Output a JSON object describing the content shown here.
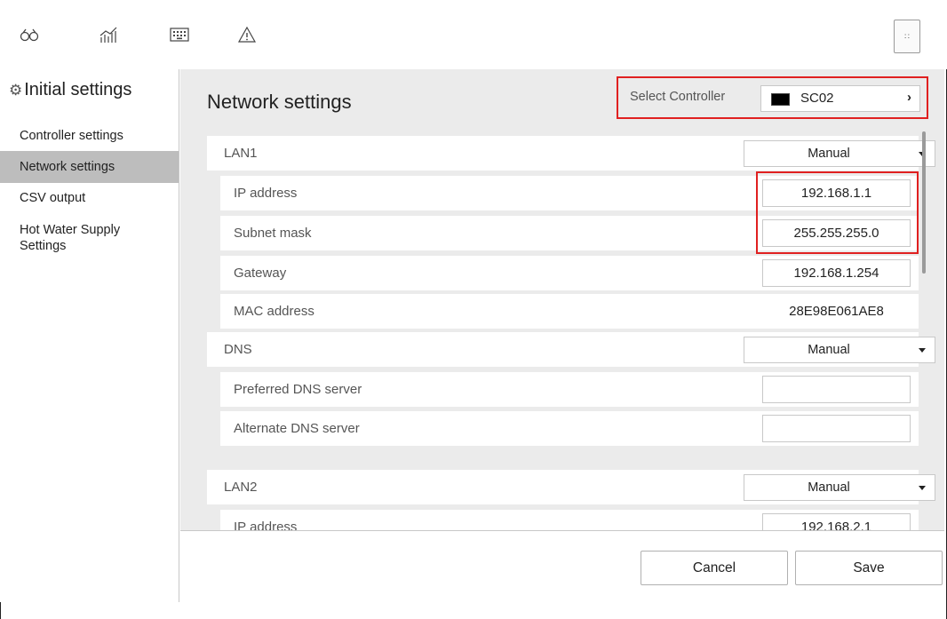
{
  "toolbar": {
    "icons": [
      "binoculars-icon",
      "chart-icon",
      "keypad-icon",
      "warning-icon"
    ],
    "menu_label": "∷"
  },
  "sidebar": {
    "title": "Initial settings",
    "items": [
      {
        "label": "Controller settings"
      },
      {
        "label": "Network settings",
        "active": true
      },
      {
        "label": "CSV output"
      },
      {
        "label": "Hot Water Supply Settings"
      }
    ]
  },
  "main": {
    "title": "Network settings",
    "controller": {
      "label": "Select Controller",
      "value": "SC02",
      "swatch_color": "#000000"
    },
    "lan1": {
      "label": "LAN1",
      "mode": "Manual",
      "ip_label": "IP address",
      "ip_value": "192.168.1.1",
      "subnet_label": "Subnet mask",
      "subnet_value": "255.255.255.0",
      "gateway_label": "Gateway",
      "gateway_value": "192.168.1.254",
      "mac_label": "MAC address",
      "mac_value": "28E98E061AE8"
    },
    "dns": {
      "label": "DNS",
      "mode": "Manual",
      "preferred_label": "Preferred DNS server",
      "preferred_value": "",
      "alternate_label": "Alternate DNS server",
      "alternate_value": ""
    },
    "lan2": {
      "label": "LAN2",
      "mode": "Manual",
      "ip_label": "IP address",
      "ip_value": "192.168.2.1"
    }
  },
  "footer": {
    "cancel_label": "Cancel",
    "save_label": "Save"
  },
  "colors": {
    "highlight": "#e02020",
    "panel_bg": "#ebebeb",
    "active_item": "#bdbdbd"
  }
}
